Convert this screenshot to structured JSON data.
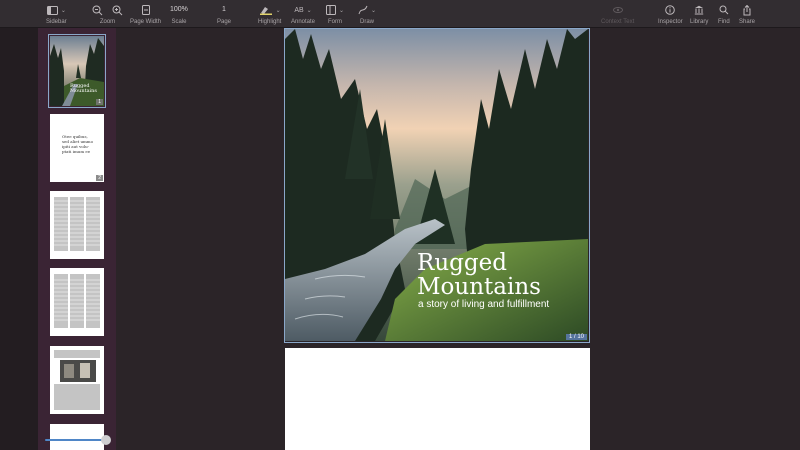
{
  "toolbar": {
    "sidebar_label": "Sidebar",
    "zoom_label": "Zoom",
    "page_width_label": "Page Width",
    "scale_label": "Scale",
    "scale_value": "100%",
    "page_label": "Page",
    "page_value": "1",
    "highlight_label": "Highlight",
    "annotate_label": "Annotate",
    "annotate_icon_text": "AB",
    "form_label": "Form",
    "draw_label": "Draw",
    "context_text_label": "Context Text",
    "inspector_label": "Inspector",
    "library_label": "Library",
    "find_label": "Find",
    "share_label": "Share"
  },
  "cover": {
    "title_line1": "Rugged",
    "title_line2": "Mountains",
    "subtitle": "a story of living and fulfillment",
    "page_indicator": "1 / 10"
  },
  "thumbnails": {
    "page1_title": "Rugged Mountains",
    "page1_num": "1",
    "page2_text": "Otee quibus, sed aliet ummo ipiti aut volu- ptati imum ee",
    "page2_num": "2"
  },
  "colors": {
    "accent": "#8aa7c9",
    "sidebar_bg": "#3a2434",
    "toolbar_bg": "#322d31"
  }
}
